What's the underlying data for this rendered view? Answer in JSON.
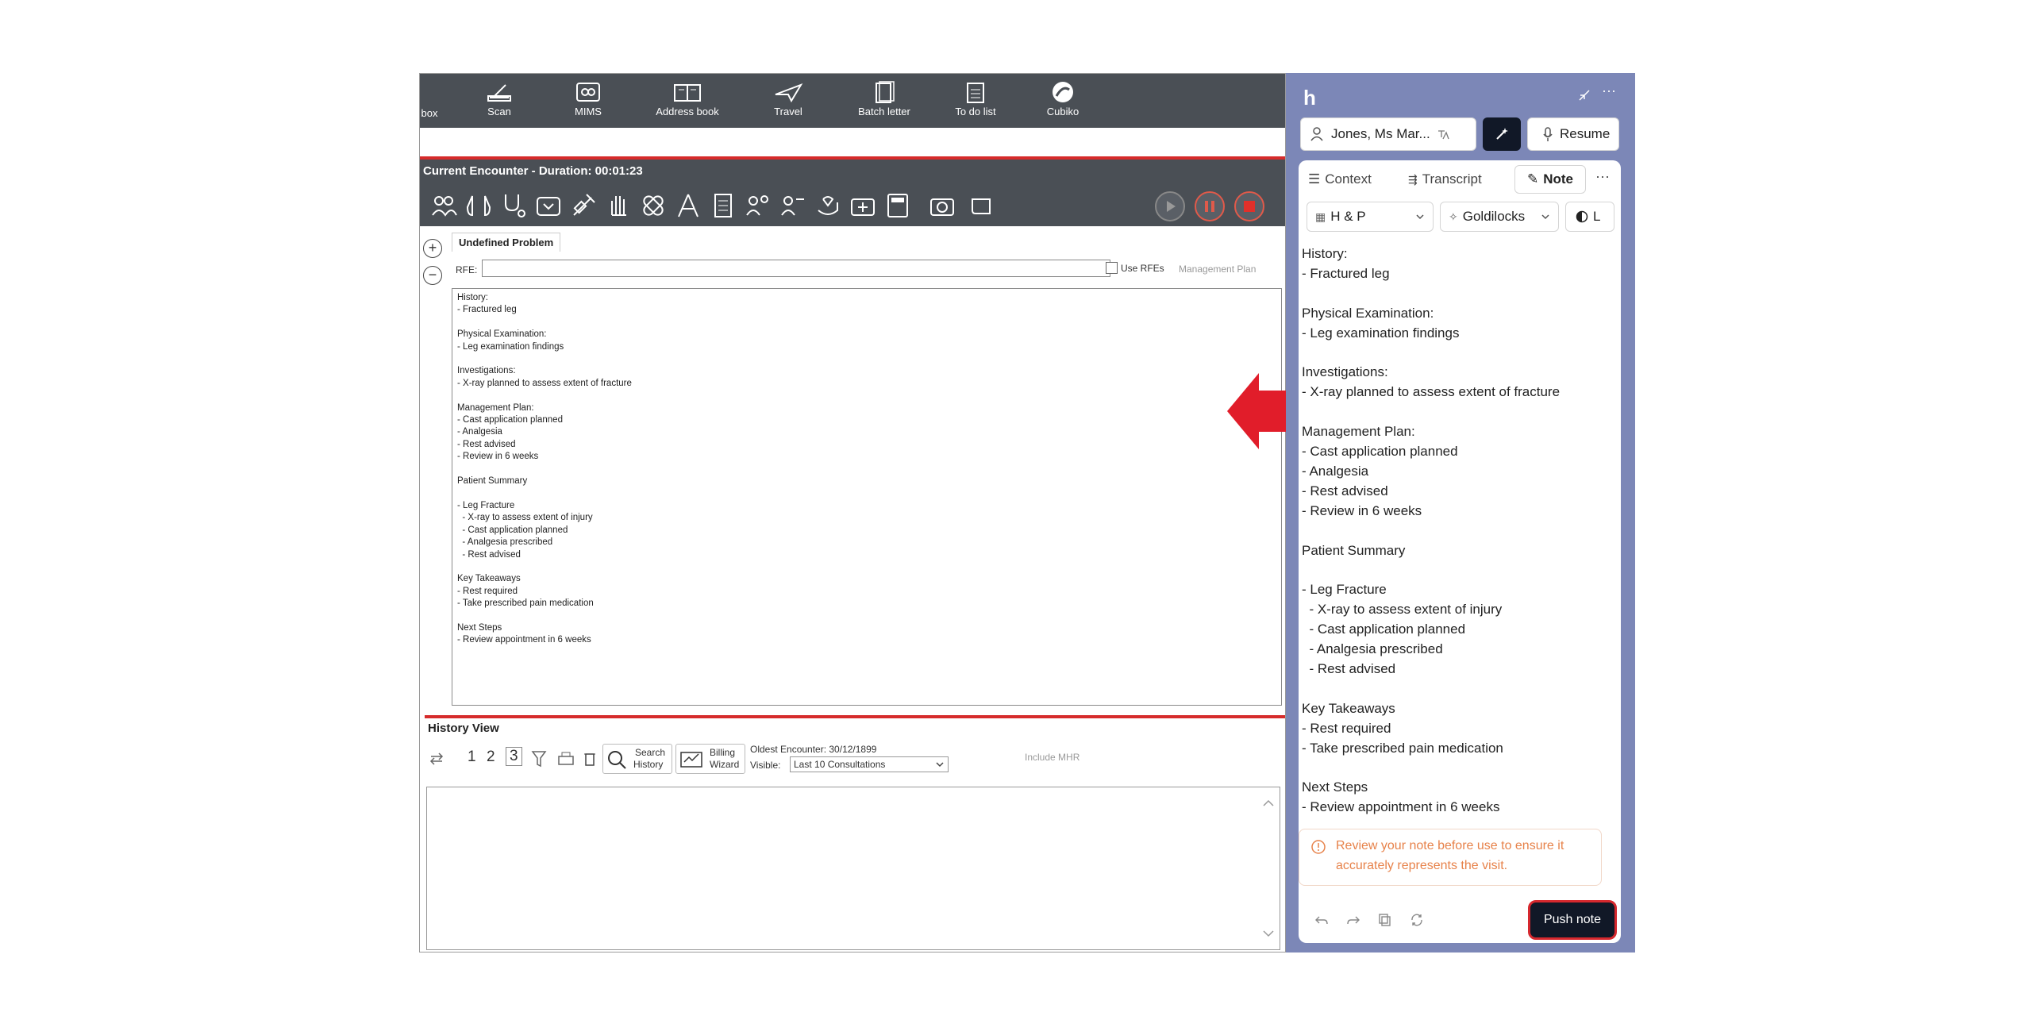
{
  "toolbar": {
    "items": [
      {
        "label": "box",
        "icon": "inbox-icon"
      },
      {
        "label": "Scan",
        "icon": "scanner-icon"
      },
      {
        "label": "MIMS",
        "icon": "mims-icon"
      },
      {
        "label": "Address book",
        "icon": "address-book-icon"
      },
      {
        "label": "Travel",
        "icon": "plane-icon"
      },
      {
        "label": "Batch letter",
        "icon": "batch-letter-icon"
      },
      {
        "label": "To do list",
        "icon": "clipboard-icon"
      },
      {
        "label": "Cubiko",
        "icon": "cubiko-icon"
      }
    ]
  },
  "encounter": {
    "title": "Current Encounter - Duration: 00:01:23",
    "problem_tab": "Undefined Problem",
    "rfe_label": "RFE:",
    "use_rfes_label": "Use RFEs",
    "management_plan_label": "Management Plan",
    "note": "History:\n- Fractured leg\n\nPhysical Examination:\n- Leg examination findings\n\nInvestigations:\n- X-ray planned to assess extent of fracture\n\nManagement Plan:\n- Cast application planned\n- Analgesia\n- Rest advised\n- Review in 6 weeks\n\nPatient Summary\n\n- Leg Fracture\n  - X-ray to assess extent of injury\n  - Cast application planned\n  - Analgesia prescribed\n  - Rest advised\n\nKey Takeaways\n- Rest required\n- Take prescribed pain medication\n\nNext Steps\n- Review appointment in 6 weeks"
  },
  "history": {
    "title": "History View",
    "pages": [
      "1",
      "2",
      "3"
    ],
    "search_label_1": "Search",
    "search_label_2": "History",
    "billing_label_1": "Billing",
    "billing_label_2": "Wizard",
    "oldest_encounter": "Oldest Encounter: 30/12/1899",
    "visible_label": "Visible:",
    "visible_value": "Last 10 Consultations",
    "include_mhr": "Include MHR"
  },
  "panel": {
    "logo": "h",
    "patient_name": "Jones, Ms Mar...",
    "resume_label": "Resume",
    "tabs": [
      {
        "label": "Context",
        "active": false
      },
      {
        "label": "Transcript",
        "active": false
      },
      {
        "label": "Note",
        "active": true
      }
    ],
    "template_label": "H & P",
    "style_label": "Goldilocks",
    "mode_label": "L",
    "note": "History:\n- Fractured leg\n\nPhysical Examination:\n- Leg examination findings\n\nInvestigations:\n- X-ray planned to assess extent of fracture\n\nManagement Plan:\n- Cast application planned\n- Analgesia\n- Rest advised\n- Review in 6 weeks\n\nPatient Summary\n\n- Leg Fracture\n  - X-ray to assess extent of injury\n  - Cast application planned\n  - Analgesia prescribed\n  - Rest advised\n\nKey Takeaways\n- Rest required\n- Take prescribed pain medication\n\nNext Steps\n- Review appointment in 6 weeks",
    "warning": "Review your note before use to ensure it accurately represents the visit.",
    "push_label": "Push note"
  },
  "colors": {
    "toolbar_bg": "#4a4f55",
    "accent_red": "#d62b2b",
    "panel_bg": "#7c87b7",
    "dark_button": "#111827",
    "warning_text": "#e7824a"
  }
}
